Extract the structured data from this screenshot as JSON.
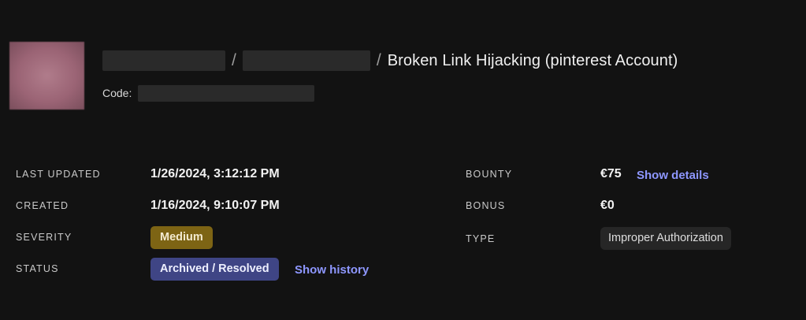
{
  "header": {
    "title": "Broken Link Hijacking (pinterest Account)",
    "separator": "/",
    "code_label": "Code:"
  },
  "details": {
    "last_updated_label": "LAST UPDATED",
    "last_updated_value": "1/26/2024, 3:12:12 PM",
    "created_label": "CREATED",
    "created_value": "1/16/2024, 9:10:07 PM",
    "severity_label": "SEVERITY",
    "severity_value": "Medium",
    "status_label": "STATUS",
    "status_value": "Archived / Resolved",
    "show_history": "Show history",
    "bounty_label": "BOUNTY",
    "bounty_value": "€75",
    "show_details": "Show details",
    "bonus_label": "BONUS",
    "bonus_value": "€0",
    "type_label": "TYPE",
    "type_value": "Improper Authorization"
  },
  "colors": {
    "background": "#121212",
    "severity_medium": "#7d6414",
    "status_badge": "#3f4585",
    "link": "#8e97ff"
  }
}
